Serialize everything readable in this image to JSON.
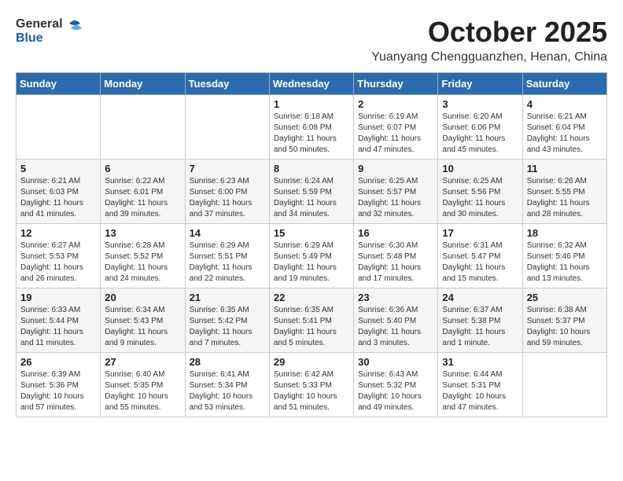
{
  "header": {
    "logo_general": "General",
    "logo_blue": "Blue",
    "month": "October 2025",
    "location": "Yuanyang Chengguanzhen, Henan, China"
  },
  "weekdays": [
    "Sunday",
    "Monday",
    "Tuesday",
    "Wednesday",
    "Thursday",
    "Friday",
    "Saturday"
  ],
  "weeks": [
    [
      {
        "day": "",
        "info": ""
      },
      {
        "day": "",
        "info": ""
      },
      {
        "day": "",
        "info": ""
      },
      {
        "day": "1",
        "info": "Sunrise: 6:18 AM\nSunset: 6:08 PM\nDaylight: 11 hours\nand 50 minutes."
      },
      {
        "day": "2",
        "info": "Sunrise: 6:19 AM\nSunset: 6:07 PM\nDaylight: 11 hours\nand 47 minutes."
      },
      {
        "day": "3",
        "info": "Sunrise: 6:20 AM\nSunset: 6:06 PM\nDaylight: 11 hours\nand 45 minutes."
      },
      {
        "day": "4",
        "info": "Sunrise: 6:21 AM\nSunset: 6:04 PM\nDaylight: 11 hours\nand 43 minutes."
      }
    ],
    [
      {
        "day": "5",
        "info": "Sunrise: 6:21 AM\nSunset: 6:03 PM\nDaylight: 11 hours\nand 41 minutes."
      },
      {
        "day": "6",
        "info": "Sunrise: 6:22 AM\nSunset: 6:01 PM\nDaylight: 11 hours\nand 39 minutes."
      },
      {
        "day": "7",
        "info": "Sunrise: 6:23 AM\nSunset: 6:00 PM\nDaylight: 11 hours\nand 37 minutes."
      },
      {
        "day": "8",
        "info": "Sunrise: 6:24 AM\nSunset: 5:59 PM\nDaylight: 11 hours\nand 34 minutes."
      },
      {
        "day": "9",
        "info": "Sunrise: 6:25 AM\nSunset: 5:57 PM\nDaylight: 11 hours\nand 32 minutes."
      },
      {
        "day": "10",
        "info": "Sunrise: 6:25 AM\nSunset: 5:56 PM\nDaylight: 11 hours\nand 30 minutes."
      },
      {
        "day": "11",
        "info": "Sunrise: 6:26 AM\nSunset: 5:55 PM\nDaylight: 11 hours\nand 28 minutes."
      }
    ],
    [
      {
        "day": "12",
        "info": "Sunrise: 6:27 AM\nSunset: 5:53 PM\nDaylight: 11 hours\nand 26 minutes."
      },
      {
        "day": "13",
        "info": "Sunrise: 6:28 AM\nSunset: 5:52 PM\nDaylight: 11 hours\nand 24 minutes."
      },
      {
        "day": "14",
        "info": "Sunrise: 6:29 AM\nSunset: 5:51 PM\nDaylight: 11 hours\nand 22 minutes."
      },
      {
        "day": "15",
        "info": "Sunrise: 6:29 AM\nSunset: 5:49 PM\nDaylight: 11 hours\nand 19 minutes."
      },
      {
        "day": "16",
        "info": "Sunrise: 6:30 AM\nSunset: 5:48 PM\nDaylight: 11 hours\nand 17 minutes."
      },
      {
        "day": "17",
        "info": "Sunrise: 6:31 AM\nSunset: 5:47 PM\nDaylight: 11 hours\nand 15 minutes."
      },
      {
        "day": "18",
        "info": "Sunrise: 6:32 AM\nSunset: 5:46 PM\nDaylight: 11 hours\nand 13 minutes."
      }
    ],
    [
      {
        "day": "19",
        "info": "Sunrise: 6:33 AM\nSunset: 5:44 PM\nDaylight: 11 hours\nand 11 minutes."
      },
      {
        "day": "20",
        "info": "Sunrise: 6:34 AM\nSunset: 5:43 PM\nDaylight: 11 hours\nand 9 minutes."
      },
      {
        "day": "21",
        "info": "Sunrise: 6:35 AM\nSunset: 5:42 PM\nDaylight: 11 hours\nand 7 minutes."
      },
      {
        "day": "22",
        "info": "Sunrise: 6:35 AM\nSunset: 5:41 PM\nDaylight: 11 hours\nand 5 minutes."
      },
      {
        "day": "23",
        "info": "Sunrise: 6:36 AM\nSunset: 5:40 PM\nDaylight: 11 hours\nand 3 minutes."
      },
      {
        "day": "24",
        "info": "Sunrise: 6:37 AM\nSunset: 5:38 PM\nDaylight: 11 hours\nand 1 minute."
      },
      {
        "day": "25",
        "info": "Sunrise: 6:38 AM\nSunset: 5:37 PM\nDaylight: 10 hours\nand 59 minutes."
      }
    ],
    [
      {
        "day": "26",
        "info": "Sunrise: 6:39 AM\nSunset: 5:36 PM\nDaylight: 10 hours\nand 57 minutes."
      },
      {
        "day": "27",
        "info": "Sunrise: 6:40 AM\nSunset: 5:35 PM\nDaylight: 10 hours\nand 55 minutes."
      },
      {
        "day": "28",
        "info": "Sunrise: 6:41 AM\nSunset: 5:34 PM\nDaylight: 10 hours\nand 53 minutes."
      },
      {
        "day": "29",
        "info": "Sunrise: 6:42 AM\nSunset: 5:33 PM\nDaylight: 10 hours\nand 51 minutes."
      },
      {
        "day": "30",
        "info": "Sunrise: 6:43 AM\nSunset: 5:32 PM\nDaylight: 10 hours\nand 49 minutes."
      },
      {
        "day": "31",
        "info": "Sunrise: 6:44 AM\nSunset: 5:31 PM\nDaylight: 10 hours\nand 47 minutes."
      },
      {
        "day": "",
        "info": ""
      }
    ]
  ]
}
